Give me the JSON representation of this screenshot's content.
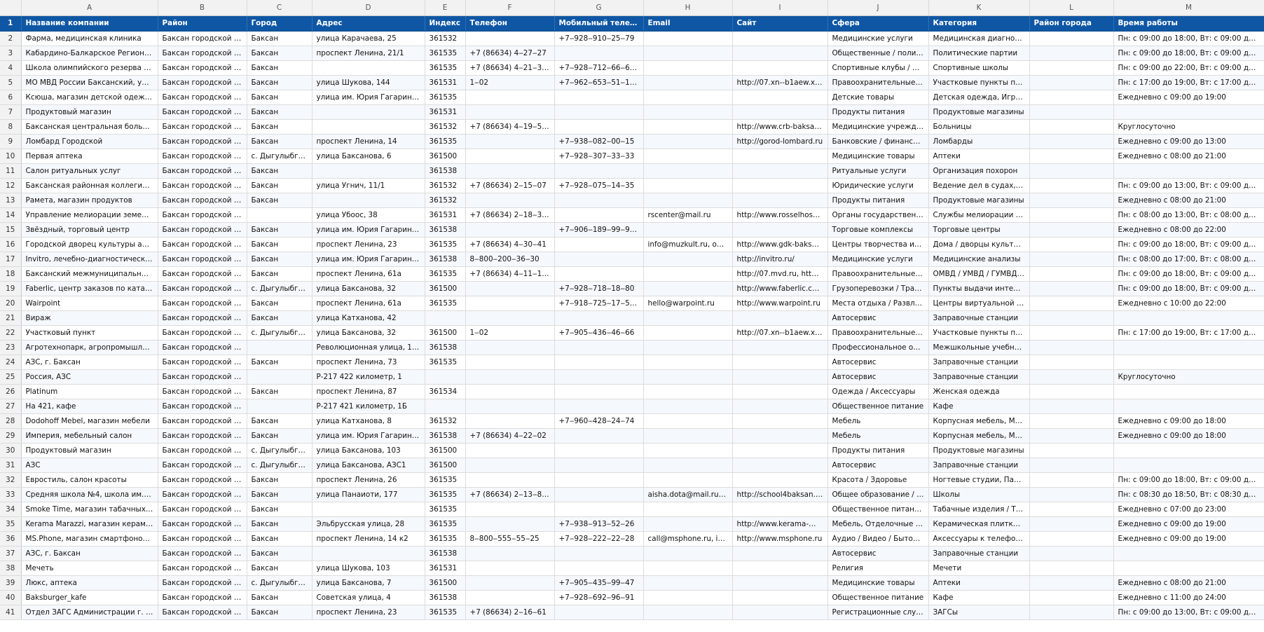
{
  "sheet": {
    "column_letters": [
      "A",
      "B",
      "C",
      "D",
      "E",
      "F",
      "G",
      "H",
      "I",
      "J",
      "K",
      "L",
      "M"
    ],
    "header_row_number": "1",
    "headers": [
      "Название компании",
      "Район",
      "Город",
      "Адрес",
      "Индекс",
      "Телефон",
      "Мобильный телефон",
      "Email",
      "Сайт",
      "Сфера",
      "Категория",
      "Район города",
      "Время работы"
    ],
    "rows": [
      {
        "n": "2",
        "cells": [
          "Фарма, медицинская клиника",
          "Баксан городской округ",
          "Баксан",
          "улица Карачаева, 25",
          "361532",
          "",
          "+7‒928‒910‒25‒79",
          "",
          "",
          "Медицинские услуги",
          "Медицинская диагностика",
          "",
          "Пн: с 09:00 до 18:00, Вт: с 09:00 до 18:00, С..."
        ]
      },
      {
        "n": "3",
        "cells": [
          "Кабардино-Балкарское Региональное...",
          "Баксан городской округ",
          "Баксан",
          "проспект Ленина, 21/1",
          "361535",
          "+7 (86634) 4‒27‒27",
          "",
          "",
          "",
          "Общественные / политиче...",
          "Политические партии",
          "",
          "Пн: с 09:00 до 18:00, Вт: с 09:00 до 18:00, С..."
        ]
      },
      {
        "n": "4",
        "cells": [
          "Школа олимпийского резерва городс...",
          "Баксан городской округ",
          "Баксан",
          "",
          "361535",
          "+7 (86634) 4‒21‒32, +7...",
          "+7‒928‒712‒66‒64, +7...",
          "",
          "",
          "Спортивные клубы / школы",
          "Спортивные школы",
          "",
          "Пн: с 09:00 до 22:00, Вт: с 09:00 до 22:00, С..."
        ]
      },
      {
        "n": "5",
        "cells": [
          "МО МВД России Баксанский, участко...",
          "Баксан городской округ",
          "Баксан",
          "улица Шукова, 144",
          "361531",
          "1‒02",
          "+7‒962‒653‒51‒11, +7...",
          "",
          "http://07.xn--b1aew.xn--p...",
          "Правоохранительные орга...",
          "Участковые пункты полиц...",
          "",
          "Пн: с 17:00 до 19:00, Вт: с 17:00 до 19:00, С..."
        ]
      },
      {
        "n": "6",
        "cells": [
          "Ксюша, магазин детской одежды",
          "Баксан городской округ",
          "Баксан",
          "улица им. Юрия Гагарина, 96",
          "361535",
          "",
          "",
          "",
          "",
          "Детские товары",
          "Детская одежда, Игрушки",
          "",
          "Ежедневно с 09:00 до 19:00"
        ]
      },
      {
        "n": "7",
        "cells": [
          "Продуктовый магазин",
          "Баксан городской округ",
          "Баксан",
          "",
          "361531",
          "",
          "",
          "",
          "",
          "Продукты питания",
          "Продуктовые магазины",
          "",
          ""
        ]
      },
      {
        "n": "8",
        "cells": [
          "Баксанская центральная больница, хи...",
          "Баксан городской округ",
          "Баксан",
          "",
          "361532",
          "+7 (86634) 4‒19‒58, +7...",
          "",
          "",
          "http://www.crb-baksan.ru",
          "Медицинские учреждения",
          "Больницы",
          "",
          "Круглосуточно"
        ]
      },
      {
        "n": "9",
        "cells": [
          "Ломбард Городской",
          "Баксан городской округ",
          "Баксан",
          "проспект Ленина, 14",
          "361535",
          "",
          "+7‒938‒082‒00‒15",
          "",
          "http://gorod-lombard.ru",
          "Банковские / финансовые ...",
          "Ломбарды",
          "",
          "Ежедневно с 09:00 до 13:00"
        ]
      },
      {
        "n": "10",
        "cells": [
          "Первая аптека",
          "Баксан городской округ",
          "с. Дыгулыбгей",
          "улица Баксанова, 6",
          "361500",
          "",
          "+7‒928‒307‒33‒33",
          "",
          "",
          "Медицинские товары",
          "Аптеки",
          "",
          "Ежедневно с 08:00 до 21:00"
        ]
      },
      {
        "n": "11",
        "cells": [
          "Салон ритуальных услуг",
          "Баксан городской округ",
          "Баксан",
          "",
          "361538",
          "",
          "",
          "",
          "",
          "Ритуальные услуги",
          "Организация похорон",
          "",
          ""
        ]
      },
      {
        "n": "12",
        "cells": [
          "Баксанская районная коллегия адвок...",
          "Баксан городской округ",
          "Баксан",
          "улица Угнич, 11/1",
          "361532",
          "+7 (86634) 2‒15‒07",
          "+7‒928‒075‒14‒35",
          "",
          "",
          "Юридические услуги",
          "Ведение дел в судах, Услуг...",
          "",
          "Пн: с 09:00 до 13:00, Вт: с 09:00 до 13:00, С..."
        ]
      },
      {
        "n": "13",
        "cells": [
          "Рамета, магазин продуктов",
          "Баксан городской округ",
          "Баксан",
          "",
          "361532",
          "",
          "",
          "",
          "",
          "Продукты питания",
          "Продуктовые магазины",
          "",
          "Ежедневно с 08:00 до 21:00"
        ]
      },
      {
        "n": "14",
        "cells": [
          "Управление мелиорации земель и се...",
          "Баксан городской округ",
          "",
          "улица Убоос, 38",
          "361531",
          "+7 (86634) 2‒18‒39, +7...",
          "",
          "rscenter@mail.ru",
          "http://www.rosselhoscent...",
          "Органы государственного ...",
          "Службы мелиорации земе...",
          "",
          "Пн: с 08:00 до 13:00, Вт: с 08:00 до 13:00, С..."
        ]
      },
      {
        "n": "15",
        "cells": [
          "Звёздный, торговый центр",
          "Баксан городской округ",
          "Баксан",
          "улица им. Юрия Гагарина, 4а",
          "361538",
          "",
          "+7‒906‒189‒99‒96, +7...",
          "",
          "",
          "Торговые комплексы",
          "Торговые центры",
          "",
          "Ежедневно с 08:00 до 22:00"
        ]
      },
      {
        "n": "16",
        "cells": [
          "Городской дворец культуры админис...",
          "Баксан городской округ",
          "Баксан",
          "проспект Ленина, 23",
          "361535",
          "+7 (86634) 4‒30‒41",
          "",
          "info@muzkult.ru, op3@...",
          "http://www.gdk-baksan.k...",
          "Центры творчества и досуга",
          "Дома / дворцы культуры",
          "",
          "Пн: с 09:00 до 18:00, Вт: с 09:00 до 18:00, С..."
        ]
      },
      {
        "n": "17",
        "cells": [
          "Invitro, лечебно-диагностический цен...",
          "Баксан городской округ",
          "Баксан",
          "улица им. Юрия Гагарина, 2д",
          "361538",
          "8‒800‒200‒36‒30",
          "",
          "",
          "http://invitro.ru/",
          "Медицинские услуги",
          "Медицинские анализы",
          "",
          "Пн: с 08:00 до 17:00, Вт: с 08:00 до 17:00, С..."
        ]
      },
      {
        "n": "18",
        "cells": [
          "Баксанский межмуниципальный отде...",
          "Баксан городской округ",
          "Баксан",
          "проспект Ленина, 61а",
          "361535",
          "+7 (86634) 4‒11‒11, 1‒...",
          "",
          "",
          "http://07.mvd.ru, http://0...",
          "Правоохранительные орга...",
          "ОМВД / УМВД / ГУМВД / ...",
          "",
          "Пн: с 09:00 до 18:00, Вт: с 09:00 до 18:00, С..."
        ]
      },
      {
        "n": "19",
        "cells": [
          "Faberlic, центр заказов по каталогам",
          "Баксан городской округ",
          "с. Дыгулыбгей",
          "улица Баксанова, 32",
          "361500",
          "",
          "+7‒928‒718‒18‒80",
          "",
          "http://www.faberlic.com",
          "Грузоперевозки / Транспо...",
          "Пункты выдачи интернет-...",
          "",
          "Пн: с 09:00 до 18:00, Вт: с 09:00 до 18:00, С..."
        ]
      },
      {
        "n": "20",
        "cells": [
          "Wairpoint",
          "Баксан городской округ",
          "Баксан",
          "проспект Ленина, 61а",
          "361535",
          "",
          "+7‒918‒725‒17‒58, +7...",
          "hello@warpoint.ru",
          "http://www.warpoint.ru",
          "Места отдыха / Развлекате...",
          "Центры виртуальной реал...",
          "",
          "Ежедневно с 10:00 до 22:00"
        ]
      },
      {
        "n": "21",
        "cells": [
          "Вираж",
          "Баксан городской округ",
          "Баксан",
          "улица Катханова, 42",
          "",
          "",
          "",
          "",
          "",
          "Автосервис",
          "Заправочные станции",
          "",
          ""
        ]
      },
      {
        "n": "22",
        "cells": [
          "Участковый пункт",
          "Баксан городской округ",
          "с. Дыгулыбгей",
          "улица Баксанова, 32",
          "361500",
          "1‒02",
          "+7‒905‒436‒46‒66",
          "",
          "http://07.xn--b1aew.xn--p...",
          "Правоохранительные орга...",
          "Участковые пункты полиц...",
          "",
          "Пн: с 17:00 до 19:00, Вт: с 17:00 до 19:00, С..."
        ]
      },
      {
        "n": "23",
        "cells": [
          "Агротехнопарк, агропромышленный ...",
          "Баксан городской округ",
          "",
          "Революционная улица, 1/1а",
          "361538",
          "",
          "",
          "",
          "",
          "Профессиональное образ...",
          "Межшкольные учебные к...",
          "",
          ""
        ]
      },
      {
        "n": "24",
        "cells": [
          "АЗС, г. Баксан",
          "Баксан городской округ",
          "Баксан",
          "проспект Ленина, 73",
          "361535",
          "",
          "",
          "",
          "",
          "Автосервис",
          "Заправочные станции",
          "",
          ""
        ]
      },
      {
        "n": "25",
        "cells": [
          "Россия, АЗС",
          "Баксан городской округ",
          "",
          "Р-217 422 километр, 1",
          "",
          "",
          "",
          "",
          "",
          "Автосервис",
          "Заправочные станции",
          "",
          "Круглосуточно"
        ]
      },
      {
        "n": "26",
        "cells": [
          "Platinum",
          "Баксан городской округ",
          "Баксан",
          "проспект Ленина, 87",
          "361534",
          "",
          "",
          "",
          "",
          "Одежда / Аксессуары",
          "Женская одежда",
          "",
          ""
        ]
      },
      {
        "n": "27",
        "cells": [
          "На 421, кафе",
          "Баксан городской округ",
          "",
          "Р-217 421 километр, 1Б",
          "",
          "",
          "",
          "",
          "",
          "Общественное питание",
          "Кафе",
          "",
          ""
        ]
      },
      {
        "n": "28",
        "cells": [
          "Dodohoff Mebel, магазин мебели",
          "Баксан городской округ",
          "Баксан",
          "улица Катханова, 8",
          "361532",
          "",
          "+7‒960‒428‒24‒74",
          "",
          "",
          "Мебель",
          "Корпусная мебель, Мебел...",
          "",
          "Ежедневно с 09:00 до 18:00"
        ]
      },
      {
        "n": "29",
        "cells": [
          "Империя, мебельный салон",
          "Баксан городской округ",
          "Баксан",
          "улица им. Юрия Гагарина, 83",
          "361538",
          "+7 (86634) 4‒22‒02",
          "",
          "",
          "",
          "Мебель",
          "Корпусная мебель, Мягкая...",
          "",
          "Ежедневно с 09:00 до 18:00"
        ]
      },
      {
        "n": "30",
        "cells": [
          "Продуктовый магазин",
          "Баксан городской округ",
          "с. Дыгулыбгей",
          "улица Баксанова, 103",
          "361500",
          "",
          "",
          "",
          "",
          "Продукты питания",
          "Продуктовые магазины",
          "",
          ""
        ]
      },
      {
        "n": "31",
        "cells": [
          "АЗС",
          "Баксан городской округ",
          "с. Дыгулыбгей",
          "улица Баксанова, АЗС1",
          "361500",
          "",
          "",
          "",
          "",
          "Автосервис",
          "Заправочные станции",
          "",
          ""
        ]
      },
      {
        "n": "32",
        "cells": [
          "Евростиль, салон красоты",
          "Баксан городской округ",
          "Баксан",
          "проспект Ленина, 26",
          "361535",
          "",
          "",
          "",
          "",
          "Красота / Здоровье",
          "Ногтевые студии, Парикма...",
          "",
          "Пн: с 09:00 до 18:00, Вт: с 09:00 до 18:00, С..."
        ]
      },
      {
        "n": "33",
        "cells": [
          "Средняя школа №4, школа им. М.А. С...",
          "Баксан городской округ",
          "Баксан",
          "улица Панаиоти, 177",
          "361535",
          "+7 (86634) 2‒13‒85, +7...",
          "",
          "aisha.dota@mail.ru, doy...",
          "http://school4baksan.ru/",
          "Общее образование / Цен...",
          "Школы",
          "",
          "Пн: с 08:30 до 18:50, Вт: с 08:30 до 18:50, С..."
        ]
      },
      {
        "n": "34",
        "cells": [
          "Smoke Time, магазин табачных издел...",
          "Баксан городской округ",
          "Баксан",
          "",
          "361535",
          "",
          "",
          "",
          "",
          "Общественное питание, П...",
          "Табачные изделия / Товар...",
          "",
          "Ежедневно с 07:00 до 23:00"
        ]
      },
      {
        "n": "35",
        "cells": [
          "Kerama Marazzi, магазин керамики",
          "Баксан городской округ",
          "Баксан",
          "Эльбрусская улица, 28",
          "361535",
          "",
          "+7‒938‒913‒52‒26",
          "",
          "http://www.kerama-maraz...",
          "Мебель, Отделочные мате...",
          "Керамическая плитка, Ме...",
          "",
          "Ежедневно с 09:00 до 19:00"
        ]
      },
      {
        "n": "36",
        "cells": [
          "MS.Phone, магазин смартфонов и тех...",
          "Баксан городской округ",
          "Баксан",
          "проспект Ленина, 14 к2",
          "361535",
          "8‒800‒555‒55‒25",
          "+7‒928‒222‒22‒28",
          "call@msphone.ru, info...",
          "http://www.msphone.ru",
          "Аудио / Видео / Бытовая т...",
          "Аксессуары к телефонам, ...",
          "",
          "Ежедневно с 09:00 до 19:00"
        ]
      },
      {
        "n": "37",
        "cells": [
          "АЗС, г. Баксан",
          "Баксан городской округ",
          "Баксан",
          "",
          "361538",
          "",
          "",
          "",
          "",
          "Автосервис",
          "Заправочные станции",
          "",
          ""
        ]
      },
      {
        "n": "38",
        "cells": [
          "Мечеть",
          "Баксан городской округ",
          "Баксан",
          "улица Шукова, 103",
          "361531",
          "",
          "",
          "",
          "",
          "Религия",
          "Мечети",
          "",
          ""
        ]
      },
      {
        "n": "39",
        "cells": [
          "Люкс, аптека",
          "Баксан городской округ",
          "с. Дыгулыбгей",
          "улица Баксанова, 7",
          "361500",
          "",
          "+7‒905‒435‒99‒47",
          "",
          "",
          "Медицинские товары",
          "Аптеки",
          "",
          "Ежедневно с 08:00 до 21:00"
        ]
      },
      {
        "n": "40",
        "cells": [
          "Baksburger_kafe",
          "Баксан городской округ",
          "Баксан",
          "Советская улица, 4",
          "361538",
          "",
          "+7‒928‒692‒96‒91",
          "",
          "",
          "Общественное питание",
          "Кафе",
          "",
          "Ежедневно с 11:00 до 24:00"
        ]
      },
      {
        "n": "41",
        "cells": [
          "Отдел ЗАГС Администрации г. Баксана",
          "Баксан городской округ",
          "Баксан",
          "проспект Ленина, 23",
          "361535",
          "+7 (86634) 2‒16‒61",
          "",
          "",
          "",
          "Регистрационные службы",
          "ЗАГСы",
          "",
          "Пн: с 09:00 до 13:00, Вт: с 09:00 до 13:00, С..."
        ]
      }
    ]
  },
  "colors": {
    "header_blue": "#0f57a4",
    "header_text": "#ffffff",
    "row_alt": "#f5f8fc",
    "gridline": "#dcdcdc"
  }
}
